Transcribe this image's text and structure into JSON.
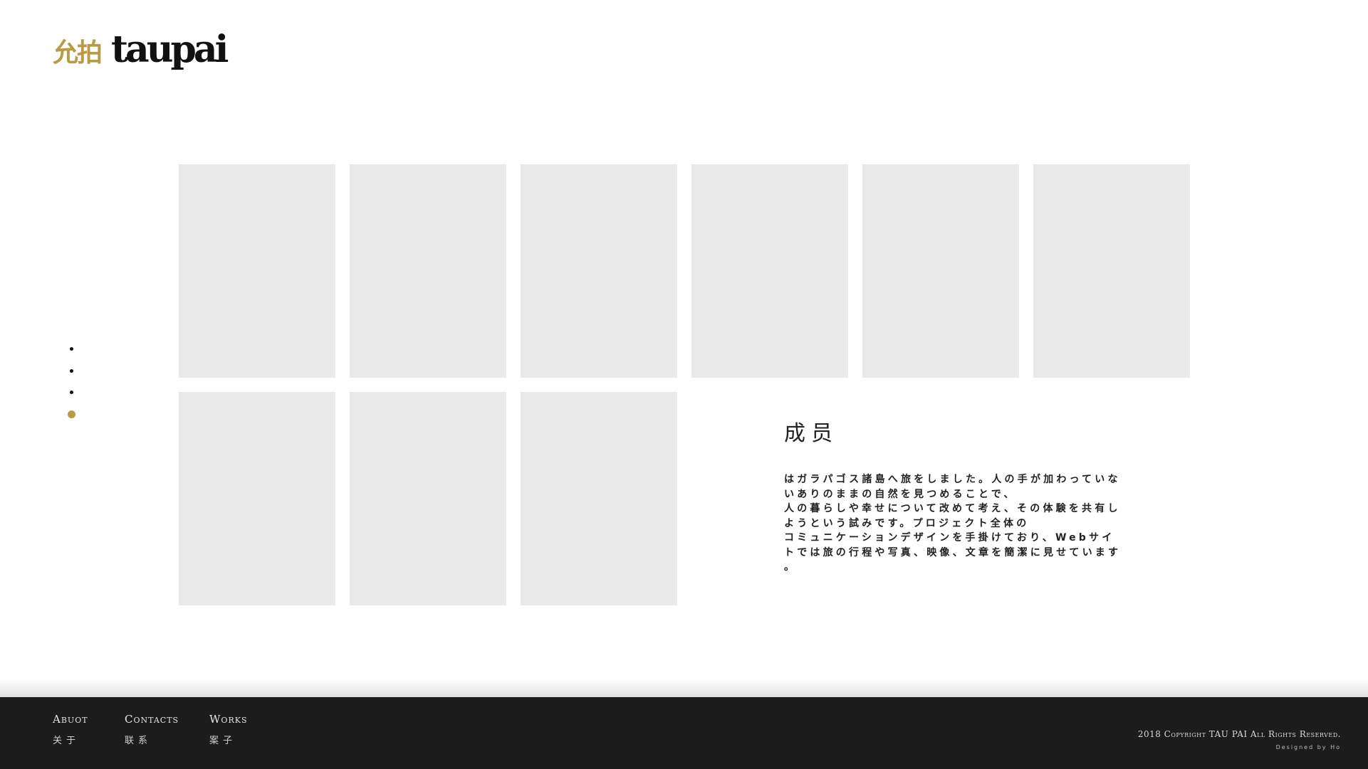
{
  "logo": {
    "mark": "允拍",
    "wordmark": "taupai",
    "colors": {
      "mark": "#b99b45",
      "wordmark": "#111111"
    }
  },
  "side_nav": {
    "dots": 4,
    "active_index": 3,
    "active_color": "#b99b45"
  },
  "gallery": {
    "tile_color": "#e9e9e9",
    "row1_count": 6,
    "row2_count": 3
  },
  "member": {
    "title": "成员",
    "lines": [
      "はガラパゴス諸島へ旅をしました。人の手が加わっていな",
      "いありのままの自然を見つめることで、",
      "人の暮らしや幸せについて改めて考え、その体験を共有し",
      "ようという試みです。プロジェクト全体の",
      "コミュニケーションデザインを手掛けており、Webサイ",
      "トでは旅の行程や写真、映像、文章を簡潔に見せています",
      "。"
    ]
  },
  "footer": {
    "background": "#1b1c1b",
    "nav": [
      {
        "en": "ABUOT",
        "cn": "关于"
      },
      {
        "en": "CONTACTS",
        "cn": "联系"
      },
      {
        "en": "WORKS",
        "cn": "案子"
      }
    ],
    "copyright": "2018 Copyright TAU PAI All Rights Reserved.",
    "designed_by": "Designed by Ho"
  }
}
